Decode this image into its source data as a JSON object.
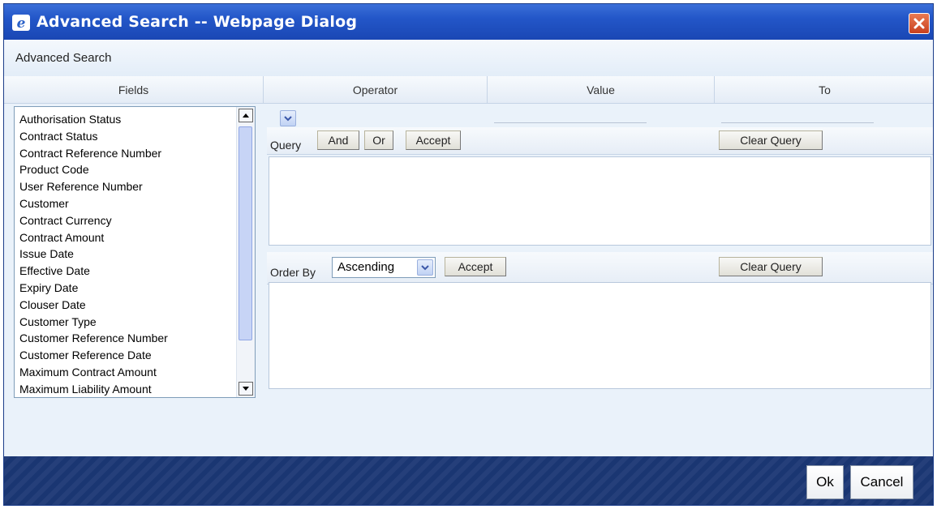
{
  "window": {
    "title": "Advanced Search -- Webpage Dialog",
    "subtitle": "Advanced Search"
  },
  "columns": {
    "fields": "Fields",
    "operator": "Operator",
    "value": "Value",
    "to": "To"
  },
  "fields_list": [
    "Authorisation Status",
    "Contract Status",
    "Contract Reference Number",
    "Product Code",
    "User Reference Number",
    "Customer",
    "Contract Currency",
    "Contract Amount",
    "Issue Date",
    "Effective Date",
    "Expiry Date",
    "Clouser Date",
    "Customer Type",
    "Customer Reference Number",
    "Customer Reference Date",
    "Maximum Contract Amount",
    "Maximum Liability Amount"
  ],
  "query": {
    "label": "Query",
    "and_label": "And",
    "or_label": "Or",
    "accept_label": "Accept",
    "clear_label": "Clear Query"
  },
  "order": {
    "label": "Order By",
    "selected": "Ascending",
    "accept_label": "Accept",
    "clear_label": "Clear Query"
  },
  "footer": {
    "ok_label": "Ok",
    "cancel_label": "Cancel"
  },
  "colors": {
    "titlebar": "#2356c8",
    "footer": "#1f3d78",
    "background": "#eaf2fa"
  }
}
